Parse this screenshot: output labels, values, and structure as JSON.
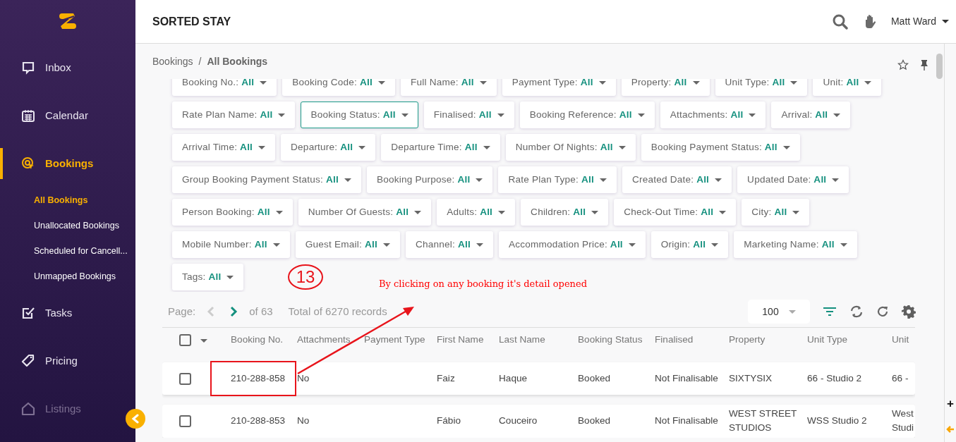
{
  "app": {
    "title": "SORTED STAY"
  },
  "sidebar": {
    "items": [
      {
        "kind": "inbox",
        "label": "Inbox",
        "selected": false,
        "disabled": false
      },
      {
        "kind": "calendar",
        "label": "Calendar",
        "selected": false,
        "disabled": false
      },
      {
        "kind": "bookings",
        "label": "Bookings",
        "selected": true,
        "disabled": false,
        "children": [
          {
            "label": "All Bookings",
            "selected": true
          },
          {
            "label": "Unallocated Bookings",
            "selected": false
          },
          {
            "label": "Scheduled for Cancell...",
            "selected": false
          },
          {
            "label": "Unmapped Bookings",
            "selected": false
          }
        ]
      },
      {
        "kind": "tasks",
        "label": "Tasks",
        "selected": false,
        "disabled": false
      },
      {
        "kind": "pricing",
        "label": "Pricing",
        "selected": false,
        "disabled": false
      },
      {
        "kind": "listings",
        "label": "Listings",
        "selected": false,
        "disabled": true
      }
    ]
  },
  "header": {
    "user": "Matt Ward"
  },
  "breadcrumb": {
    "items": [
      "Bookings",
      "All Bookings"
    ],
    "separator": "/"
  },
  "filters": [
    [
      {
        "label": "Booking No.:",
        "value": "All",
        "selected": false
      },
      {
        "label": "Booking Code:",
        "value": "All",
        "selected": false
      },
      {
        "label": "Full Name:",
        "value": "All",
        "selected": false
      },
      {
        "label": "Payment Type:",
        "value": "All",
        "selected": false
      },
      {
        "label": "Property:",
        "value": "All",
        "selected": false
      },
      {
        "label": "Unit Type:",
        "value": "All",
        "selected": false
      },
      {
        "label": "Unit:",
        "value": "All",
        "selected": false
      }
    ],
    [
      {
        "label": "Rate Plan Name:",
        "value": "All",
        "selected": false
      },
      {
        "label": "Booking Status:",
        "value": "All",
        "selected": true
      },
      {
        "label": "Finalised:",
        "value": "All",
        "selected": false
      },
      {
        "label": "Booking Reference:",
        "value": "All",
        "selected": false
      },
      {
        "label": "Attachments:",
        "value": "All",
        "selected": false
      },
      {
        "label": "Arrival:",
        "value": "All",
        "selected": false
      }
    ],
    [
      {
        "label": "Arrival Time:",
        "value": "All",
        "selected": false
      },
      {
        "label": "Departure:",
        "value": "All",
        "selected": false
      },
      {
        "label": "Departure Time:",
        "value": "All",
        "selected": false
      },
      {
        "label": "Number Of Nights:",
        "value": "All",
        "selected": false
      },
      {
        "label": "Booking Payment Status:",
        "value": "All",
        "selected": false
      }
    ],
    [
      {
        "label": "Group Booking Payment Status:",
        "value": "All",
        "selected": false
      },
      {
        "label": "Booking Purpose:",
        "value": "All",
        "selected": false
      },
      {
        "label": "Rate Plan Type:",
        "value": "All",
        "selected": false
      },
      {
        "label": "Created Date:",
        "value": "All",
        "selected": false
      },
      {
        "label": "Updated Date:",
        "value": "All",
        "selected": false
      }
    ],
    [
      {
        "label": "Person Booking:",
        "value": "All",
        "selected": false
      },
      {
        "label": "Number Of Guests:",
        "value": "All",
        "selected": false
      },
      {
        "label": "Adults:",
        "value": "All",
        "selected": false
      },
      {
        "label": "Children:",
        "value": "All",
        "selected": false
      },
      {
        "label": "Check-Out Time:",
        "value": "All",
        "selected": false
      },
      {
        "label": "City:",
        "value": "All",
        "selected": false
      }
    ],
    [
      {
        "label": "Mobile Number:",
        "value": "All",
        "selected": false
      },
      {
        "label": "Guest Email:",
        "value": "All",
        "selected": false
      },
      {
        "label": "Channel:",
        "value": "All",
        "selected": false
      },
      {
        "label": "Accommodation Price:",
        "value": "All",
        "selected": false
      },
      {
        "label": "Origin:",
        "value": "All",
        "selected": false
      },
      {
        "label": "Marketing Name:",
        "value": "All",
        "selected": false
      }
    ],
    [
      {
        "label": "Tags:",
        "value": "All",
        "selected": false
      }
    ]
  ],
  "pager": {
    "label": "Page:",
    "prev_disabled": true,
    "next_disabled": false,
    "of": "of 63",
    "total": "Total of 6270 records",
    "page_size": "100"
  },
  "table": {
    "all_checked": false,
    "columns": [
      "Booking No.",
      "Attachments",
      "Payment Type",
      "First Name",
      "Last Name",
      "Booking Status",
      "Finalised",
      "Property",
      "Unit Type",
      "Unit"
    ],
    "rows": [
      {
        "checked": false,
        "highlighted": true,
        "cells": [
          "210-288-858",
          "No",
          null,
          "Faiz",
          "Haque",
          "Booked",
          "Not Finalisable",
          "SIXTYSIX",
          "66 - Studio 2",
          "66 -"
        ]
      },
      {
        "checked": false,
        "highlighted": false,
        "cells": [
          "210-288-853",
          "No",
          null,
          "Fábio",
          "Couceiro",
          "Booked",
          "Not Finalisable",
          "WEST STREET STUDIOS",
          "WSS Studio 2",
          "West Studi"
        ]
      }
    ]
  },
  "side_tools": {
    "add": "+"
  },
  "annotation": {
    "marker": "13",
    "note": "By clicking on any booking it's detail opened"
  }
}
